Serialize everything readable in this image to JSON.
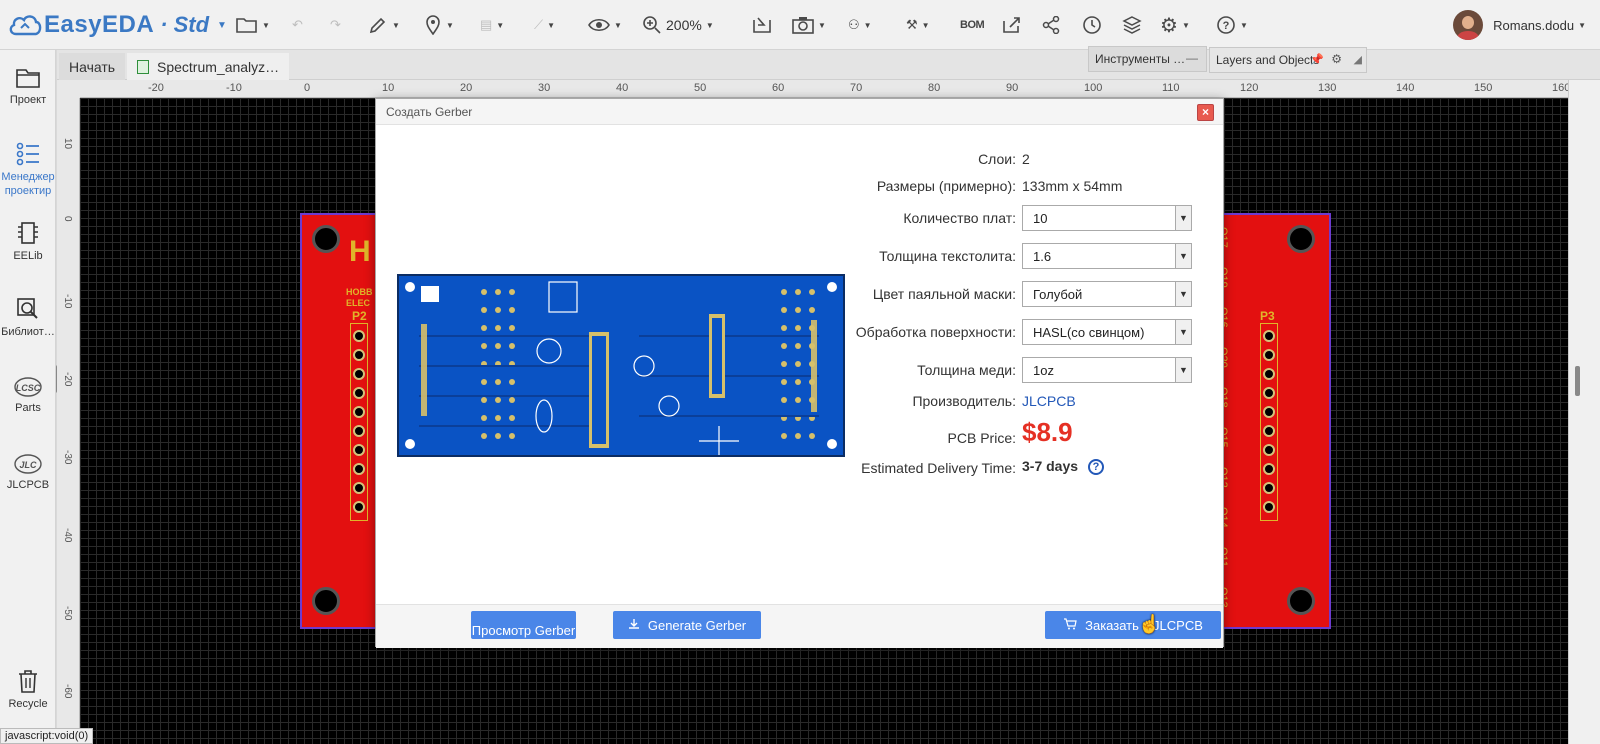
{
  "app": {
    "brand": "EasyEDA",
    "separator": "·",
    "edition": "Std"
  },
  "toolbar": {
    "zoom": "200%",
    "bom": "BOM"
  },
  "user": {
    "name": "Romans.dodu"
  },
  "sidebar": {
    "items": [
      {
        "label": "Проект",
        "icon": "folder-icon"
      },
      {
        "label": "Менеджер проектир",
        "icon": "list-icon",
        "active": true
      },
      {
        "label": "EELib",
        "icon": "chip-icon"
      },
      {
        "label": "Библиот…",
        "icon": "search-library-icon"
      },
      {
        "label": "Parts",
        "icon": "lcsc-icon"
      },
      {
        "label": "JLCPCB",
        "icon": "jlc-icon"
      },
      {
        "label": "Recycle",
        "icon": "trash-icon"
      }
    ]
  },
  "tabs": [
    {
      "label": "Начать"
    },
    {
      "label": "Spectrum_analyz…"
    }
  ],
  "panels": {
    "tools": "Инструменты …",
    "layers": "Layers and Objects"
  },
  "rulers": {
    "top": [
      "-20",
      "-10",
      "0",
      "10",
      "20",
      "30",
      "40",
      "50",
      "60",
      "70",
      "80",
      "90",
      "100",
      "110",
      "120",
      "130",
      "140",
      "150",
      "160"
    ],
    "left": [
      "10",
      "0",
      "-10",
      "-20",
      "-30",
      "-40",
      "-50",
      "-60"
    ]
  },
  "board": {
    "left_header": "P2",
    "right_header": "P3",
    "logo_text": "HOBB ELEC",
    "right_silk": [
      "Q17",
      "Q19",
      "Q16",
      "Q20",
      "Q18",
      "Q15",
      "Q12",
      "Q14",
      "Q11",
      "Q13"
    ]
  },
  "dialog": {
    "title": "Создать Gerber",
    "close": "×",
    "layers_label": "Слои:",
    "layers_value": "2",
    "size_label": "Размеры (примерно):",
    "size_value": "133mm x 54mm",
    "qty_label": "Количество плат:",
    "qty_value": "10",
    "thickness_label": "Толщина текстолита:",
    "thickness_value": "1.6",
    "mask_label": "Цвет паяльной маски:",
    "mask_value": "Голубой",
    "finish_label": "Обработка поверхности:",
    "finish_value": "HASL(со свинцом)",
    "copper_label": "Толщина меди:",
    "copper_value": "1oz",
    "maker_label": "Производитель:",
    "maker_value": "JLCPCB",
    "price_label": "PCB Price:",
    "price_value": "$8.9",
    "delivery_label": "Estimated Delivery Time:",
    "delivery_value": "3-7 days",
    "help": "?",
    "btn_preview": "Просмотр Gerber",
    "btn_generate": "Generate Gerber",
    "btn_order": "Заказать в JLCPCB"
  },
  "status": {
    "text": "javascript:void(0)"
  },
  "colors": {
    "accent": "#4a86e8",
    "brand": "#3b79c4",
    "board": "#e31010",
    "preview_mask": "#0a53c4",
    "price": "#e53024"
  }
}
